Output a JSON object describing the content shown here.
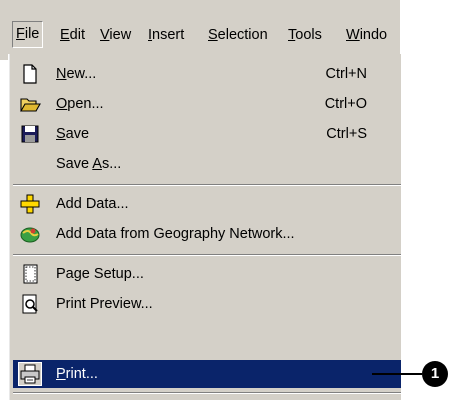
{
  "menubar": {
    "items": [
      "File",
      "Edit",
      "View",
      "Insert",
      "Selection",
      "Tools",
      "Windo"
    ],
    "mnemonics": [
      "F",
      "E",
      "V",
      "I",
      "S",
      "T",
      "W"
    ]
  },
  "file_menu": {
    "new": {
      "pre": "",
      "key": "N",
      "post": "ew...",
      "shortcut": "Ctrl+N",
      "icon": "new-document-icon"
    },
    "open": {
      "pre": "",
      "key": "O",
      "post": "pen...",
      "shortcut": "Ctrl+O",
      "icon": "open-folder-icon"
    },
    "save": {
      "pre": "",
      "key": "S",
      "post": "ave",
      "shortcut": "Ctrl+S",
      "icon": "floppy-disk-icon"
    },
    "save_as": {
      "pre": "Save ",
      "key": "A",
      "post": "s..."
    },
    "add_data": {
      "label": "Add Data...",
      "icon": "add-data-icon"
    },
    "add_data_geo": {
      "label": "Add Data from Geography Network...",
      "icon": "globe-icon"
    },
    "page_setup": {
      "label": "Page Setup...",
      "icon": "page-setup-icon"
    },
    "print_preview": {
      "label": "Print Preview...",
      "icon": "print-preview-icon"
    },
    "print": {
      "pre": "",
      "key": "P",
      "post": "rint...",
      "icon": "printer-icon",
      "selected": true
    }
  },
  "callout": {
    "number": "1"
  },
  "colors": {
    "menu_bg": "#d4d0c8",
    "selection": "#0a246a",
    "accent": "#000000"
  }
}
